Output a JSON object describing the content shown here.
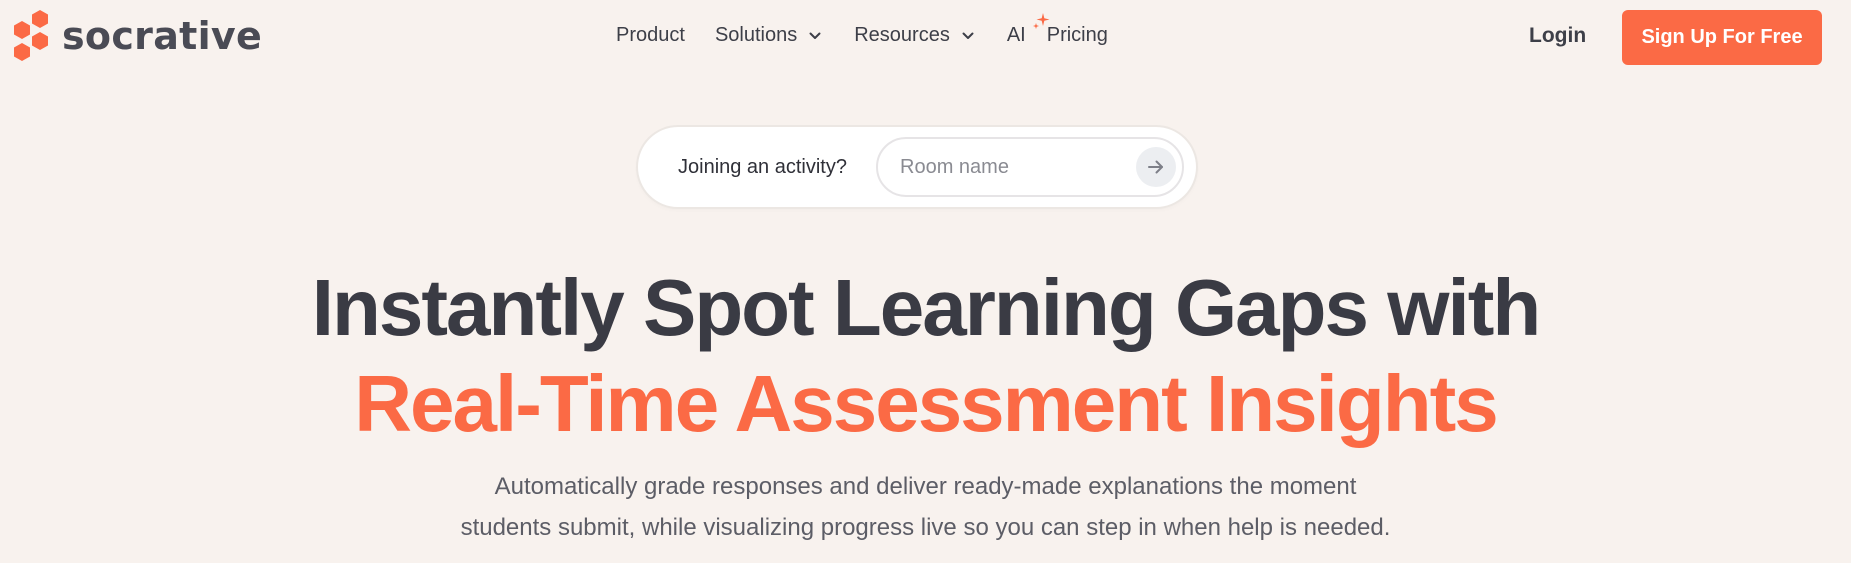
{
  "brand": {
    "name": "socrative",
    "accent_color": "#fb6a45",
    "logo_icon": "hexagon-cluster-icon"
  },
  "nav": {
    "items": [
      {
        "label": "Product",
        "has_dropdown": false
      },
      {
        "label": "Solutions",
        "has_dropdown": true
      },
      {
        "label": "Resources",
        "has_dropdown": true
      },
      {
        "label": "AI",
        "has_dropdown": false,
        "icon": "sparkle-icon"
      },
      {
        "label": "Pricing",
        "has_dropdown": false
      }
    ]
  },
  "header": {
    "login_label": "Login",
    "signup_label": "Sign Up For Free"
  },
  "join": {
    "label": "Joining an activity?",
    "placeholder": "Room name",
    "value": "",
    "submit_icon": "arrow-right-icon"
  },
  "hero": {
    "title_line1": "Instantly Spot Learning Gaps with",
    "title_line2": "Real-Time Assessment Insights",
    "subtitle_line1": "Automatically grade responses and deliver ready-made explanations the moment",
    "subtitle_line2": "students submit, while visualizing progress live so you can step in when help is needed."
  }
}
